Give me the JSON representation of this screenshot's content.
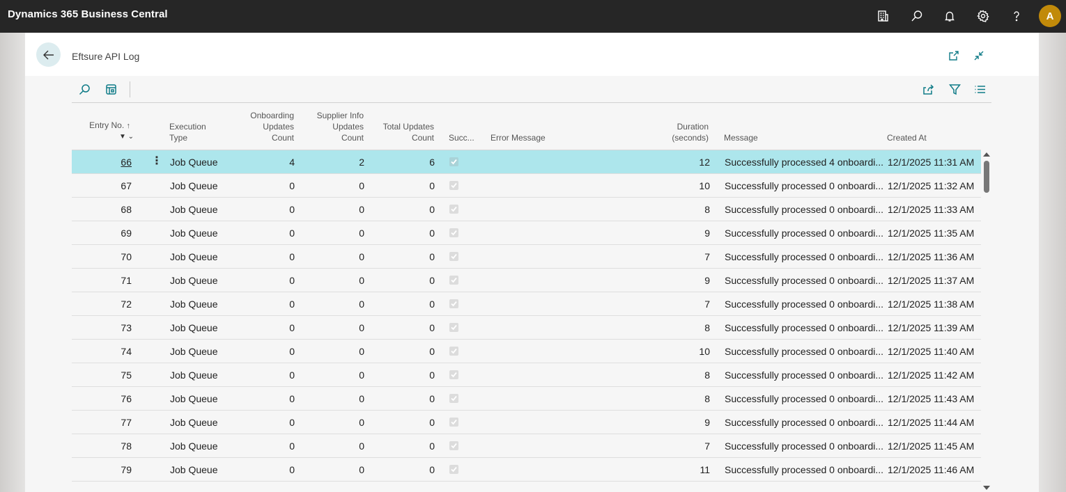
{
  "app": {
    "title": "Dynamics 365 Business Central",
    "avatar_initial": "A"
  },
  "topbar_icons": [
    "company-icon",
    "search-icon",
    "bell-icon",
    "gear-icon",
    "help-icon"
  ],
  "page": {
    "title": "Eftsure API Log"
  },
  "columns": {
    "entry_no": "Entry No.",
    "execution_type": [
      "Execution",
      "Type"
    ],
    "onboarding": [
      "Onboarding",
      "Updates",
      "Count"
    ],
    "supplier": [
      "Supplier Info",
      "Updates",
      "Count"
    ],
    "total": [
      "Total Updates",
      "Count"
    ],
    "success": "Succ...",
    "error_message": "Error Message",
    "duration": [
      "Duration",
      "(seconds)"
    ],
    "message": "Message",
    "created_at": "Created At"
  },
  "rows": [
    {
      "entry": "66",
      "type": "Job Queue",
      "onboarding": "4",
      "supplier": "2",
      "total": "6",
      "duration": "12",
      "message": "Successfully processed 4 onboardi...",
      "created": "12/1/2025 11:31 AM",
      "selected": true
    },
    {
      "entry": "67",
      "type": "Job Queue",
      "onboarding": "0",
      "supplier": "0",
      "total": "0",
      "duration": "10",
      "message": "Successfully processed 0 onboardi...",
      "created": "12/1/2025 11:32 AM"
    },
    {
      "entry": "68",
      "type": "Job Queue",
      "onboarding": "0",
      "supplier": "0",
      "total": "0",
      "duration": "8",
      "message": "Successfully processed 0 onboardi...",
      "created": "12/1/2025 11:33 AM"
    },
    {
      "entry": "69",
      "type": "Job Queue",
      "onboarding": "0",
      "supplier": "0",
      "total": "0",
      "duration": "9",
      "message": "Successfully processed 0 onboardi...",
      "created": "12/1/2025 11:35 AM"
    },
    {
      "entry": "70",
      "type": "Job Queue",
      "onboarding": "0",
      "supplier": "0",
      "total": "0",
      "duration": "7",
      "message": "Successfully processed 0 onboardi...",
      "created": "12/1/2025 11:36 AM"
    },
    {
      "entry": "71",
      "type": "Job Queue",
      "onboarding": "0",
      "supplier": "0",
      "total": "0",
      "duration": "9",
      "message": "Successfully processed 0 onboardi...",
      "created": "12/1/2025 11:37 AM"
    },
    {
      "entry": "72",
      "type": "Job Queue",
      "onboarding": "0",
      "supplier": "0",
      "total": "0",
      "duration": "7",
      "message": "Successfully processed 0 onboardi...",
      "created": "12/1/2025 11:38 AM"
    },
    {
      "entry": "73",
      "type": "Job Queue",
      "onboarding": "0",
      "supplier": "0",
      "total": "0",
      "duration": "8",
      "message": "Successfully processed 0 onboardi...",
      "created": "12/1/2025 11:39 AM"
    },
    {
      "entry": "74",
      "type": "Job Queue",
      "onboarding": "0",
      "supplier": "0",
      "total": "0",
      "duration": "10",
      "message": "Successfully processed 0 onboardi...",
      "created": "12/1/2025 11:40 AM"
    },
    {
      "entry": "75",
      "type": "Job Queue",
      "onboarding": "0",
      "supplier": "0",
      "total": "0",
      "duration": "8",
      "message": "Successfully processed 0 onboardi...",
      "created": "12/1/2025 11:42 AM"
    },
    {
      "entry": "76",
      "type": "Job Queue",
      "onboarding": "0",
      "supplier": "0",
      "total": "0",
      "duration": "8",
      "message": "Successfully processed 0 onboardi...",
      "created": "12/1/2025 11:43 AM"
    },
    {
      "entry": "77",
      "type": "Job Queue",
      "onboarding": "0",
      "supplier": "0",
      "total": "0",
      "duration": "9",
      "message": "Successfully processed 0 onboardi...",
      "created": "12/1/2025 11:44 AM"
    },
    {
      "entry": "78",
      "type": "Job Queue",
      "onboarding": "0",
      "supplier": "0",
      "total": "0",
      "duration": "7",
      "message": "Successfully processed 0 onboardi...",
      "created": "12/1/2025 11:45 AM"
    },
    {
      "entry": "79",
      "type": "Job Queue",
      "onboarding": "0",
      "supplier": "0",
      "total": "0",
      "duration": "11",
      "message": "Successfully processed 0 onboardi...",
      "created": "12/1/2025 11:46 AM"
    }
  ],
  "colors": {
    "accent": "#0f7b87",
    "selected_row": "#ade6ec",
    "topbar": "#262626",
    "avatar": "#c18a0a"
  }
}
